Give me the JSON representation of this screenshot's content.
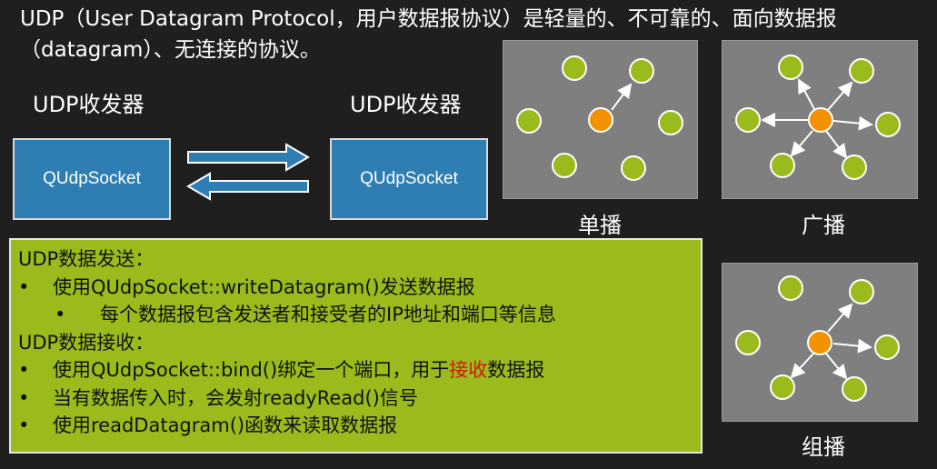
{
  "intro": "UDP（User Datagram Protocol，用户数据报协议）是轻量的、不可靠的、面向数据报（datagram）、无连接的协议。",
  "left_label": "UDP收发器",
  "right_label": "UDP收发器",
  "left_socket": "QUdpSocket",
  "right_socket": "QUdpSocket",
  "diagrams": {
    "unicast_caption": "单播",
    "broadcast_caption": "广播",
    "multicast_caption": "组播"
  },
  "colors": {
    "sender_node": "#f39200",
    "receiver_node": "#9bbb1c",
    "panel": "#7f7f7f",
    "socket_box": "#2e7eb4",
    "info_box": "#9bbb1c",
    "highlight": "#d0150d"
  },
  "info": {
    "send_title": "UDP数据发送：",
    "send_item1": "使用QUdpSocket::writeDatagram()发送数据报",
    "send_subitem": "每个数据报包含发送者和接受者的IP地址和端口等信息",
    "recv_title": "UDP数据接收：",
    "recv_item1_pre": "使用QUdpSocket::bind()绑定一个端口，用于",
    "recv_item1_highlight": "接收",
    "recv_item1_post": "数据报",
    "recv_item2": "当有数据传入时，会发射readyRead()信号",
    "recv_item3": "使用readDatagram()函数来读取数据报",
    "bullet": "•"
  }
}
